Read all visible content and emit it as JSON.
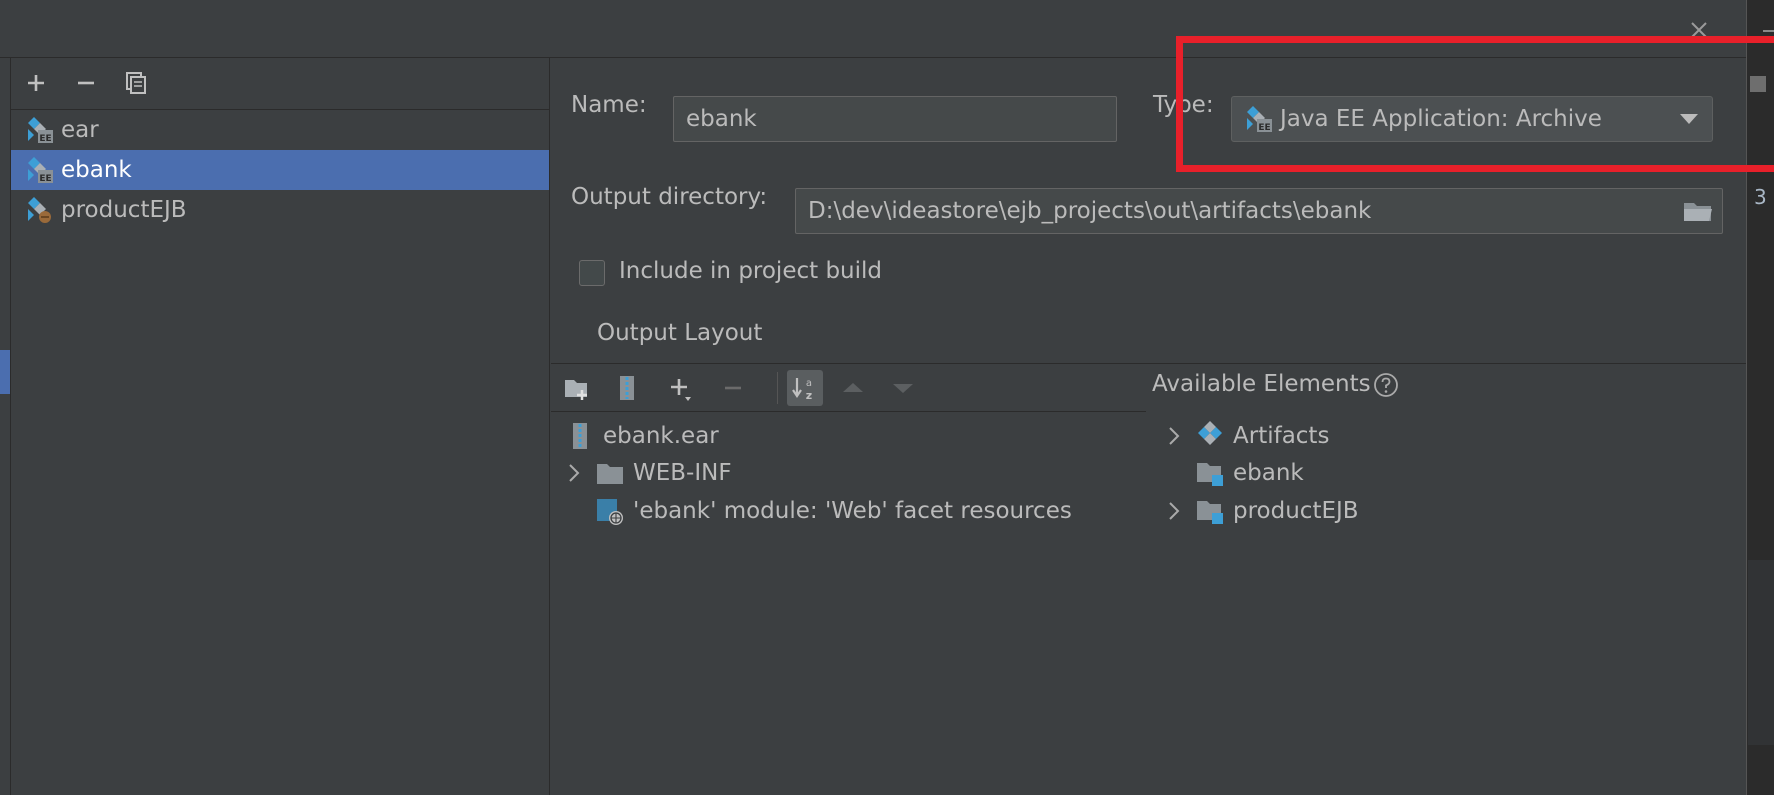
{
  "artifacts": [
    {
      "label": "ear",
      "icon": "ear-artifact-icon",
      "selected": false
    },
    {
      "label": "ebank",
      "icon": "ear-artifact-icon",
      "selected": true
    },
    {
      "label": "productEJB",
      "icon": "ejb-artifact-icon",
      "selected": false
    }
  ],
  "toolbar": {
    "add_icon": "plus-icon",
    "remove_icon": "minus-icon",
    "copy_icon": "copy-icon"
  },
  "form": {
    "name_label": "Name:",
    "name_value": "ebank",
    "type_label": "Type:",
    "type_value": "Java EE Application: Archive",
    "output_dir_label": "Output directory:",
    "output_dir_value": "D:\\dev\\ideastore\\ejb_projects\\out\\artifacts\\ebank",
    "include_build_label": "Include in project build",
    "include_build_checked": false
  },
  "output_layout": {
    "tab_label": "Output Layout",
    "tree": [
      {
        "label": "ebank.ear",
        "icon": "archive-icon",
        "expandable": false,
        "indent": 0
      },
      {
        "label": "WEB-INF",
        "icon": "folder-icon",
        "expandable": true,
        "indent": 1
      },
      {
        "label": "'ebank' module: 'Web' facet resources",
        "icon": "web-facet-icon",
        "expandable": false,
        "indent": 1
      }
    ]
  },
  "available": {
    "title": "Available Elements",
    "items": [
      {
        "label": "Artifacts",
        "icon": "artifacts-icon",
        "expandable": true
      },
      {
        "label": "ebank",
        "icon": "module-folder-icon",
        "expandable": false
      },
      {
        "label": "productEJB",
        "icon": "module-folder-icon",
        "expandable": true
      }
    ]
  },
  "edge": {
    "line_number": "3"
  },
  "colors": {
    "background": "#3c3f41",
    "selection": "#4b6eaf",
    "highlight_box": "#e8202a",
    "icon_blue": "#3d9fd6"
  }
}
